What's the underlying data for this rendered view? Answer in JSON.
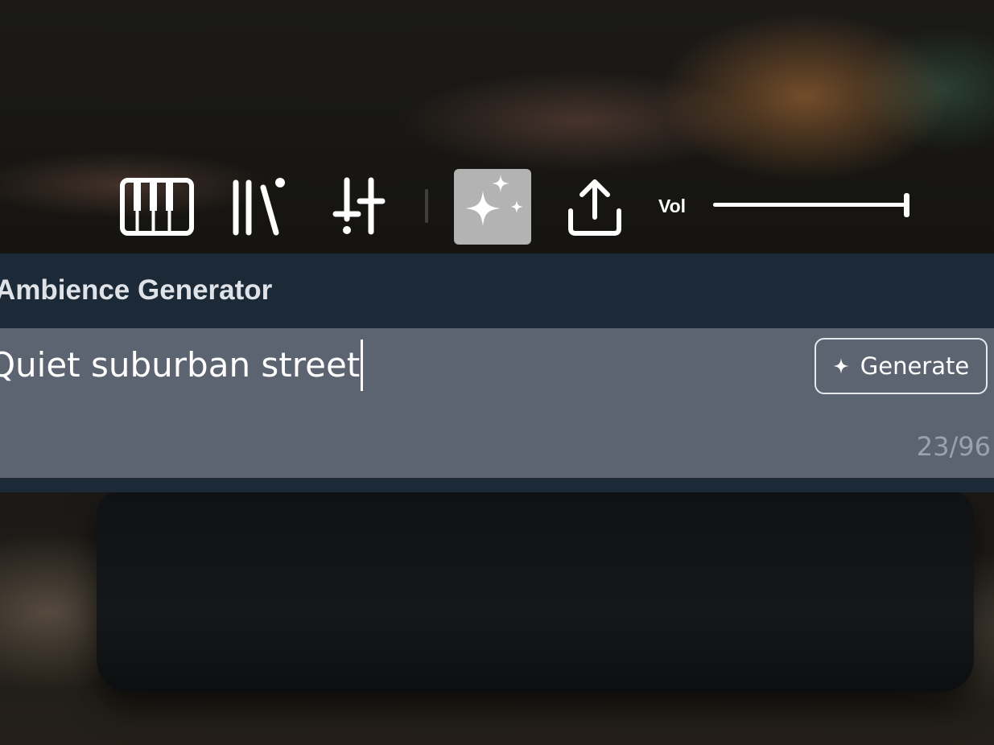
{
  "toolbar": {
    "tools": [
      {
        "icon": "piano-keys-icon",
        "active": false
      },
      {
        "icon": "library-icon",
        "active": false
      },
      {
        "icon": "mixer-sliders-icon",
        "active": false
      },
      {
        "icon": "sparkles-icon",
        "active": true
      },
      {
        "icon": "share-icon",
        "active": false
      }
    ],
    "volume": {
      "label": "Vol",
      "value_percent": 100
    }
  },
  "panel": {
    "title": "Ambience Generator",
    "prompt": {
      "value": "Quiet suburban street",
      "counter": "23/96"
    },
    "generate_button": {
      "icon": "sparkle-icon",
      "label": "Generate"
    }
  },
  "colors": {
    "panel_header": "#1c2a38",
    "input_background": "#5b6470",
    "active_tool": "#b3b3b3"
  }
}
